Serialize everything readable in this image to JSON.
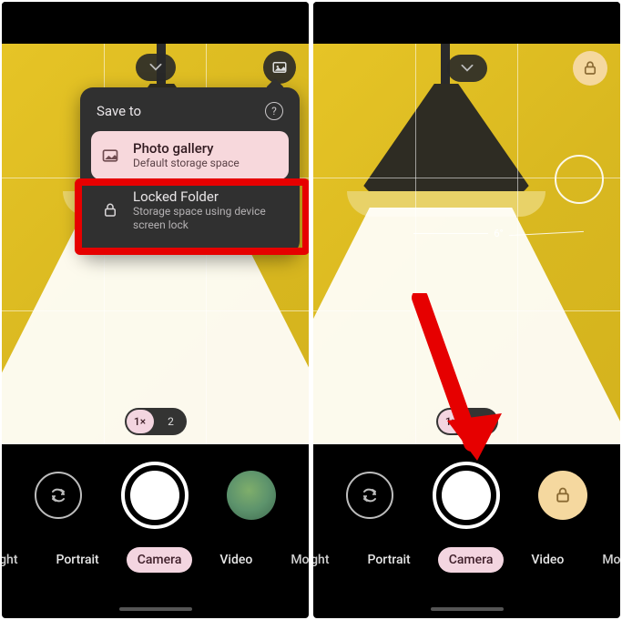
{
  "left": {
    "topbar": {
      "dropdown_icon": "chevron-down",
      "gallery_icon": "image"
    },
    "popover": {
      "title": "Save to",
      "help_label": "?",
      "options": [
        {
          "icon": "image",
          "title": "Photo gallery",
          "subtitle": "Default storage space",
          "selected": true
        },
        {
          "icon": "lock",
          "title": "Locked Folder",
          "subtitle": "Storage space using device screen lock",
          "selected": false,
          "highlighted": true
        }
      ]
    },
    "zoom": {
      "options": [
        "1×",
        "2"
      ],
      "selected": 0
    },
    "modes": {
      "items": [
        "t Sight",
        "Portrait",
        "Camera",
        "Video",
        "Modes"
      ],
      "selected": 2
    },
    "controls": {
      "left": "flip-camera",
      "center": "shutter",
      "right": "thumbnail"
    }
  },
  "right": {
    "topbar": {
      "dropdown_icon": "chevron-down",
      "lock_icon": "lock"
    },
    "level": {
      "angle": "6°"
    },
    "zoom": {
      "options": [
        "1×",
        "2"
      ],
      "selected": 0
    },
    "modes": {
      "items": [
        "t Sight",
        "Portrait",
        "Camera",
        "Video",
        "Modes"
      ],
      "selected": 2
    },
    "controls": {
      "left": "flip-camera",
      "center": "shutter",
      "right": "locked-folder"
    }
  },
  "colors": {
    "accent_pink": "#f3d5e0",
    "accent_peach": "#f5d89f",
    "highlight_red": "#e60000"
  }
}
